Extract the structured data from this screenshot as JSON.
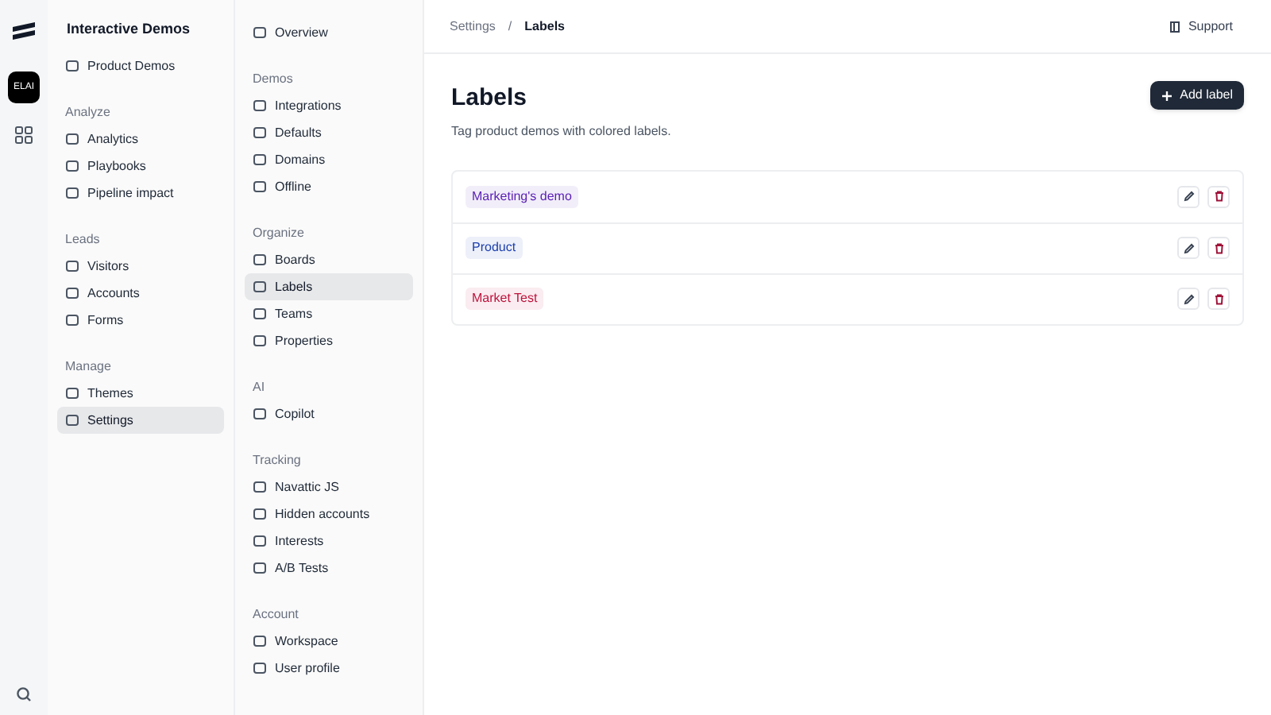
{
  "rail": {
    "workspace_badge": "ELAI"
  },
  "sidebar": {
    "title": "Interactive Demos",
    "top_item": {
      "label": "Product Demos",
      "selected": false
    },
    "sections": [
      {
        "heading": "Analyze",
        "items": [
          {
            "label": "Analytics",
            "selected": false
          },
          {
            "label": "Playbooks",
            "selected": false
          },
          {
            "label": "Pipeline impact",
            "selected": false
          }
        ]
      },
      {
        "heading": "Leads",
        "items": [
          {
            "label": "Visitors",
            "selected": false
          },
          {
            "label": "Accounts",
            "selected": false
          },
          {
            "label": "Forms",
            "selected": false
          }
        ]
      },
      {
        "heading": "Manage",
        "items": [
          {
            "label": "Themes",
            "selected": false
          },
          {
            "label": "Settings",
            "selected": true
          }
        ]
      }
    ]
  },
  "settings_nav": {
    "top_item": {
      "label": "Overview",
      "selected": false
    },
    "sections": [
      {
        "heading": "Demos",
        "items": [
          {
            "label": "Integrations",
            "selected": false
          },
          {
            "label": "Defaults",
            "selected": false
          },
          {
            "label": "Domains",
            "selected": false
          },
          {
            "label": "Offline",
            "selected": false
          }
        ]
      },
      {
        "heading": "Organize",
        "items": [
          {
            "label": "Boards",
            "selected": false
          },
          {
            "label": "Labels",
            "selected": true
          },
          {
            "label": "Teams",
            "selected": false
          },
          {
            "label": "Properties",
            "selected": false
          }
        ]
      },
      {
        "heading": "AI",
        "items": [
          {
            "label": "Copilot",
            "selected": false
          }
        ]
      },
      {
        "heading": "Tracking",
        "items": [
          {
            "label": "Navattic JS",
            "selected": false
          },
          {
            "label": "Hidden accounts",
            "selected": false
          },
          {
            "label": "Interests",
            "selected": false
          },
          {
            "label": "A/B Tests",
            "selected": false
          }
        ]
      },
      {
        "heading": "Account",
        "items": [
          {
            "label": "Workspace",
            "selected": false
          },
          {
            "label": "User profile",
            "selected": false
          }
        ]
      }
    ]
  },
  "breadcrumb": [
    "Settings",
    "/",
    "Labels"
  ],
  "support": "Support",
  "page": {
    "title": "Labels",
    "subtitle": "Tag product demos with colored labels.",
    "add_button": "Add label",
    "labels": [
      {
        "name": "Marketing's demo",
        "color": "#5b21b6"
      },
      {
        "name": "Product",
        "color": "#1e40af"
      },
      {
        "name": "Market Test",
        "color": "#be123c"
      }
    ]
  }
}
